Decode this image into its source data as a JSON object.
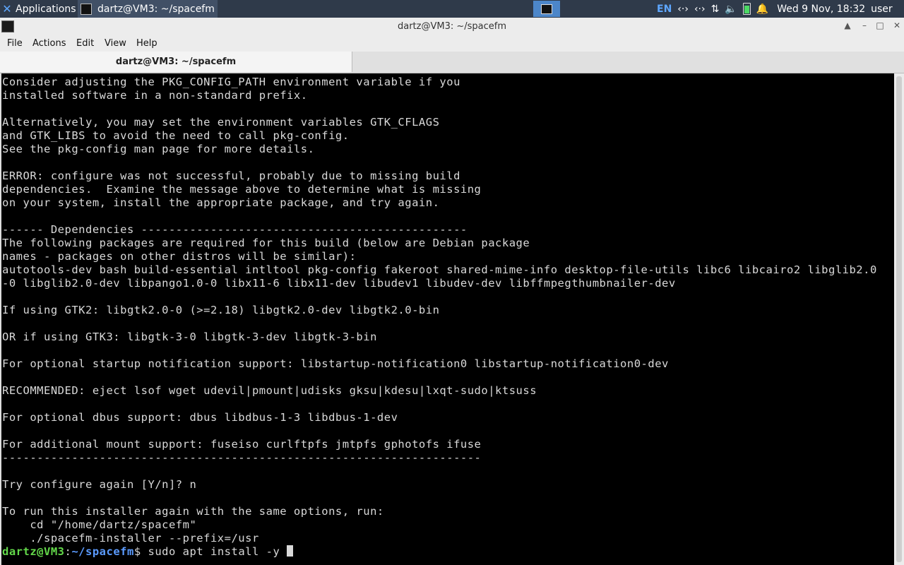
{
  "panel": {
    "applications_label": "Applications",
    "task_title": "dartz@VM3: ~/spacefm",
    "lang": "EN",
    "clock": "Wed  9 Nov, 18:32",
    "user": "user"
  },
  "window": {
    "title": "dartz@VM3: ~/spacefm",
    "controls": [
      "▲",
      "–",
      "□",
      "✕"
    ]
  },
  "menu": [
    "File",
    "Actions",
    "Edit",
    "View",
    "Help"
  ],
  "tab": {
    "label": "dartz@VM3: ~/spacefm"
  },
  "terminal": {
    "lines": [
      "Consider adjusting the PKG_CONFIG_PATH environment variable if you",
      "installed software in a non-standard prefix.",
      "",
      "Alternatively, you may set the environment variables GTK_CFLAGS",
      "and GTK_LIBS to avoid the need to call pkg-config.",
      "See the pkg-config man page for more details.",
      "",
      "ERROR: configure was not successful, probably due to missing build",
      "dependencies.  Examine the message above to determine what is missing",
      "on your system, install the appropriate package, and try again.",
      "",
      "------ Dependencies -----------------------------------------------",
      "The following packages are required for this build (below are Debian package",
      "names - packages on other distros will be similar):",
      "autotools-dev bash build-essential intltool pkg-config fakeroot shared-mime-info desktop-file-utils libc6 libcairo2 libglib2.0",
      "-0 libglib2.0-dev libpango1.0-0 libx11-6 libx11-dev libudev1 libudev-dev libffmpegthumbnailer-dev",
      "",
      "If using GTK2: libgtk2.0-0 (>=2.18) libgtk2.0-dev libgtk2.0-bin",
      "",
      "OR if using GTK3: libgtk-3-0 libgtk-3-dev libgtk-3-bin",
      "",
      "For optional startup notification support: libstartup-notification0 libstartup-notification0-dev",
      "",
      "RECOMMENDED: eject lsof wget udevil|pmount|udisks gksu|kdesu|lxqt-sudo|ktsuss",
      "",
      "For optional dbus support: dbus libdbus-1-3 libdbus-1-dev",
      "",
      "For additional mount support: fuseiso curlftpfs jmtpfs gphotofs ifuse",
      "---------------------------------------------------------------------",
      "",
      "Try configure again [Y/n]? n",
      "",
      "To run this installer again with the same options, run:",
      "    cd \"/home/dartz/spacefm\"",
      "    ./spacefm-installer --prefix=/usr"
    ],
    "prompt_user": "dartz@VM3",
    "prompt_sep": ":",
    "prompt_path": "~/spacefm",
    "prompt_symbol": "$ ",
    "command": "sudo apt install -y "
  }
}
